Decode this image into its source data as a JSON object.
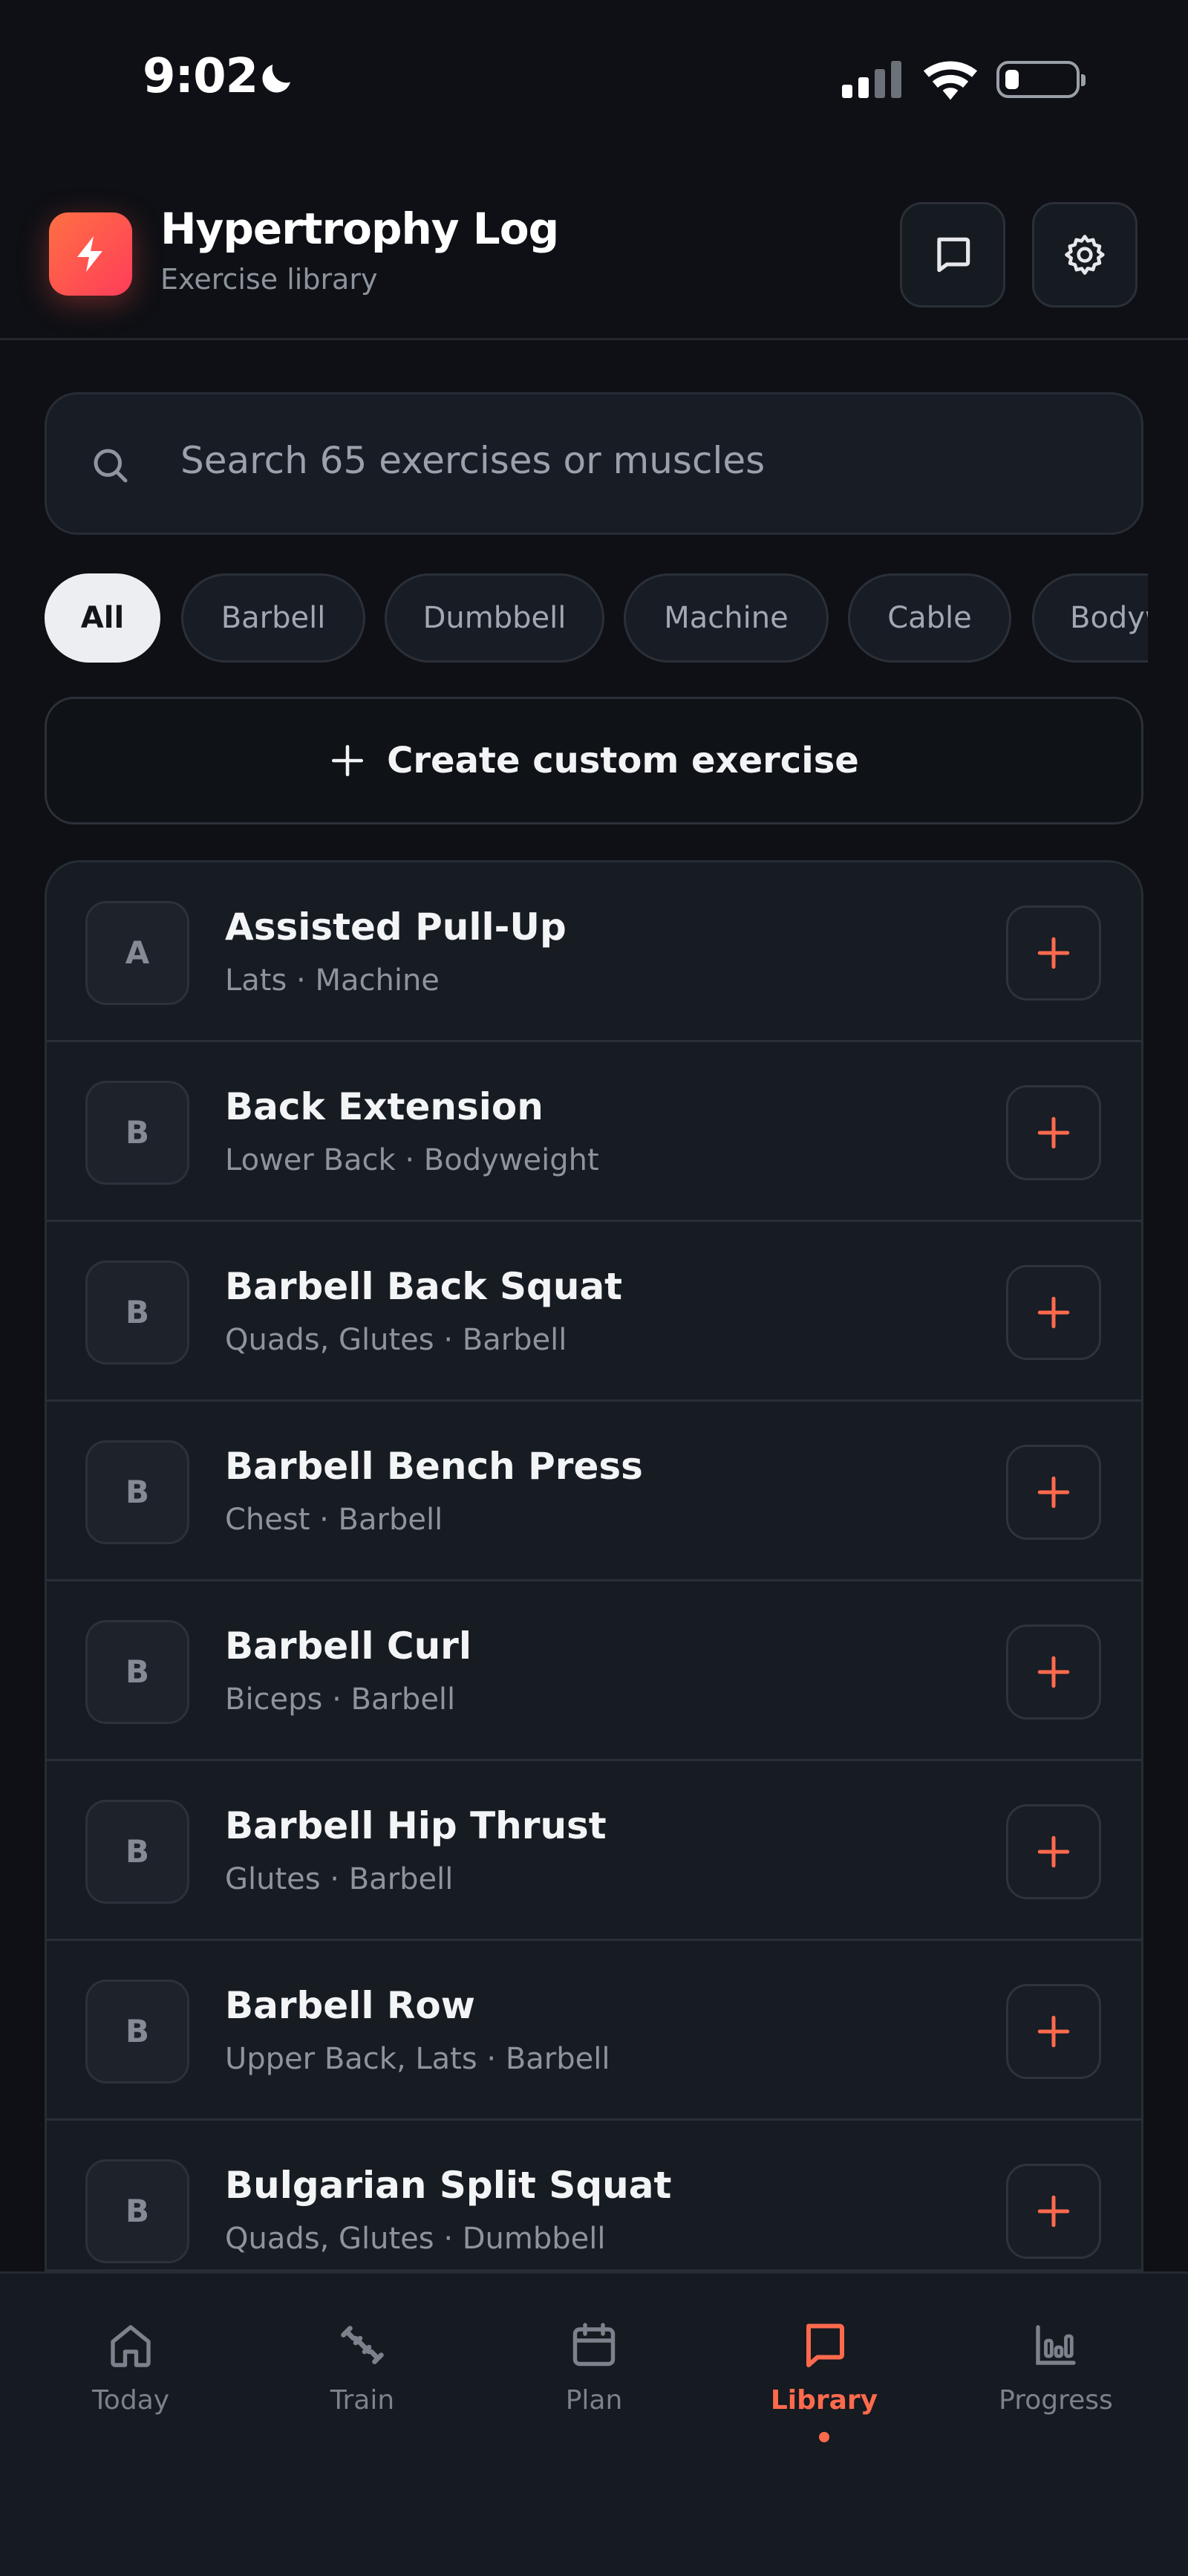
{
  "status_bar": {
    "time": "9:02"
  },
  "header": {
    "title": "Hypertrophy Log",
    "subtitle": "Exercise library"
  },
  "search": {
    "placeholder": "Search 65 exercises or muscles"
  },
  "filters": [
    {
      "label": "All",
      "active": true
    },
    {
      "label": "Barbell"
    },
    {
      "label": "Dumbbell"
    },
    {
      "label": "Machine"
    },
    {
      "label": "Cable"
    },
    {
      "label": "Bodyweight"
    }
  ],
  "create_button": {
    "label": "Create custom exercise"
  },
  "exercises": [
    {
      "initial": "A",
      "name": "Assisted Pull-Up",
      "meta": "Lats · Machine"
    },
    {
      "initial": "B",
      "name": "Back Extension",
      "meta": "Lower Back · Bodyweight"
    },
    {
      "initial": "B",
      "name": "Barbell Back Squat",
      "meta": "Quads, Glutes · Barbell"
    },
    {
      "initial": "B",
      "name": "Barbell Bench Press",
      "meta": "Chest · Barbell"
    },
    {
      "initial": "B",
      "name": "Barbell Curl",
      "meta": "Biceps · Barbell"
    },
    {
      "initial": "B",
      "name": "Barbell Hip Thrust",
      "meta": "Glutes · Barbell"
    },
    {
      "initial": "B",
      "name": "Barbell Row",
      "meta": "Upper Back, Lats · Barbell"
    },
    {
      "initial": "B",
      "name": "Bulgarian Split Squat",
      "meta": "Quads, Glutes · Dumbbell"
    }
  ],
  "tabs": [
    {
      "label": "Today",
      "icon": "home-icon"
    },
    {
      "label": "Train",
      "icon": "dumbbell-icon"
    },
    {
      "label": "Plan",
      "icon": "calendar-icon"
    },
    {
      "label": "Library",
      "icon": "book-icon",
      "active": true
    },
    {
      "label": "Progress",
      "icon": "bar-chart-icon"
    }
  ],
  "colors": {
    "accent": "#ff6a4d",
    "background": "#0e1015",
    "card": "#171b22"
  }
}
